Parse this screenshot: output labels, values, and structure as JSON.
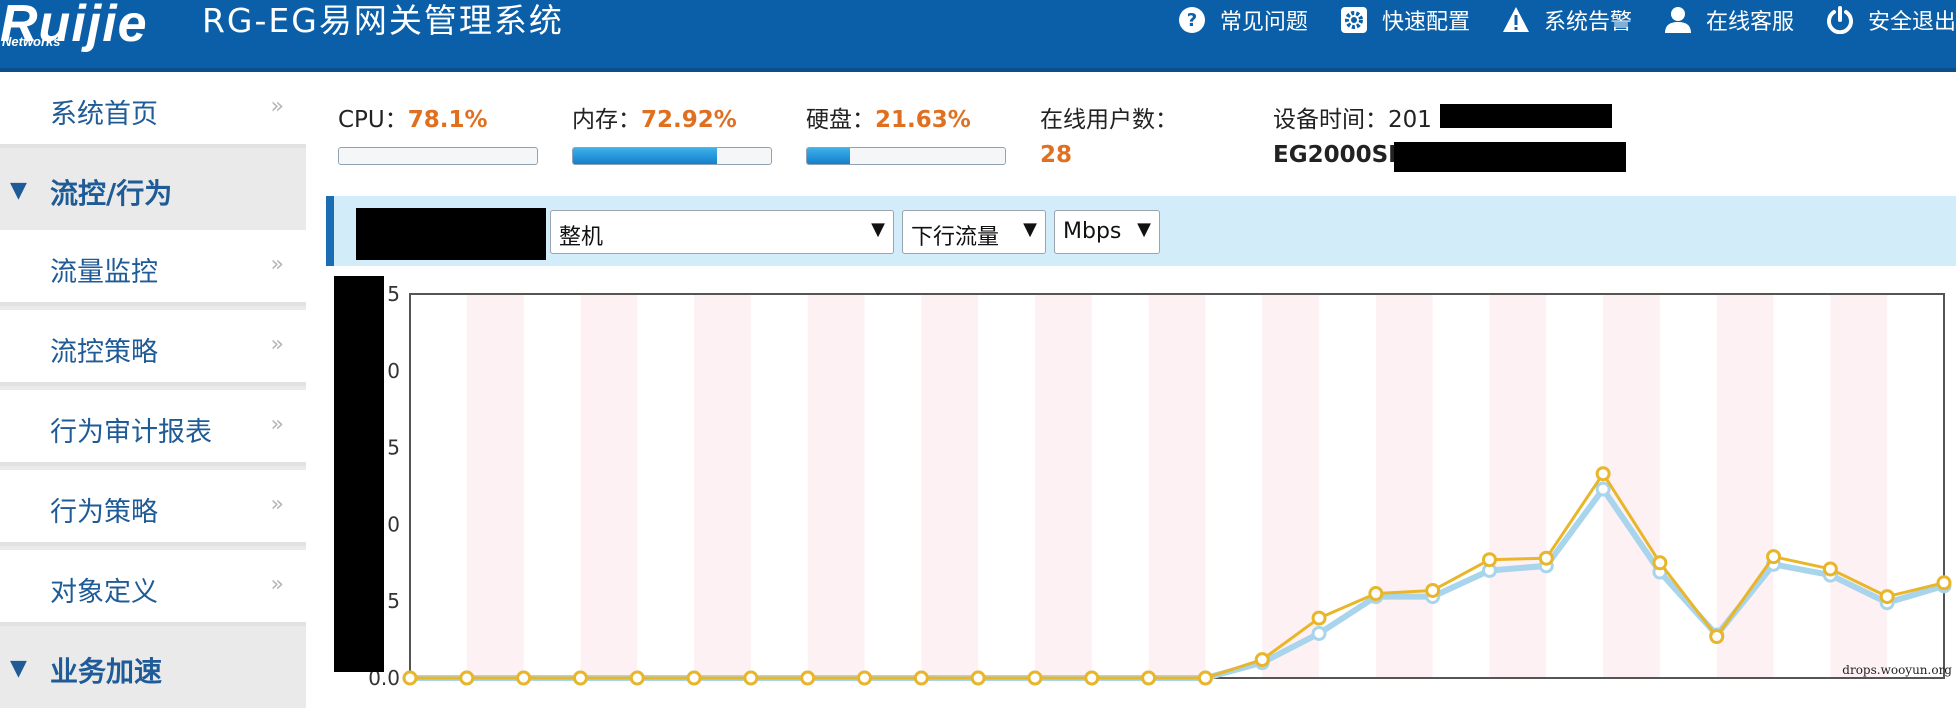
{
  "header": {
    "logo": "Ruijie",
    "logo_sub": "Networks",
    "title": "RG-EG易网关管理系统",
    "nav": [
      {
        "label": "常见问题",
        "icon": "help-icon"
      },
      {
        "label": "快速配置",
        "icon": "gear-icon"
      },
      {
        "label": "系统告警",
        "icon": "warning-icon"
      },
      {
        "label": "在线客服",
        "icon": "user-icon"
      },
      {
        "label": "安全退出",
        "icon": "power-icon"
      }
    ]
  },
  "sidebar": {
    "home": "系统首页",
    "group1": "流控/行为",
    "items": [
      "流量监控",
      "流控策略",
      "行为审计报表",
      "行为策略",
      "对象定义"
    ],
    "group2": "业务加速",
    "arrow": "»"
  },
  "stats": {
    "cpu_label": "CPU：",
    "cpu_value": "78.1%",
    "cpu_level": 0.0,
    "mem_label": "内存：",
    "mem_value": "72.92%",
    "mem_level": 0.7292,
    "disk_label": "硬盘：",
    "disk_value": "21.63%",
    "disk_level": 0.2163,
    "online_label": "在线用户数：",
    "online_value": "28",
    "time_label": "设备时间：",
    "time_value": "201",
    "model": "EG2000SE"
  },
  "toolbar": {
    "select1": "整机",
    "select2": "下行流量",
    "select3": "Mbps"
  },
  "watermark": "drops.wooyun.org",
  "chart_data": {
    "type": "line",
    "y_ticks": [
      "5",
      "0",
      "5",
      "0",
      "5",
      "0.0"
    ],
    "ylim": [
      0,
      25
    ],
    "x": [
      0,
      1,
      2,
      3,
      4,
      5,
      6,
      7,
      8,
      9,
      10,
      11,
      12,
      13,
      14,
      15,
      16,
      17,
      18,
      19,
      20,
      21,
      22,
      23,
      24,
      25,
      26,
      27
    ],
    "series": [
      {
        "color": "#e9b62a",
        "values": [
          0,
          0,
          0,
          0,
          0,
          0,
          0,
          0,
          0,
          0,
          0,
          0,
          0,
          0,
          0,
          1.2,
          3.9,
          5.5,
          5.7,
          7.7,
          7.8,
          13.3,
          7.5,
          2.7,
          7.9,
          7.1,
          5.3,
          6.2
        ]
      },
      {
        "color": "#a8d4ec",
        "values": [
          0,
          0,
          0,
          0,
          0,
          0,
          0,
          0,
          0,
          0,
          0,
          0,
          0,
          0,
          0,
          1.0,
          2.9,
          5.3,
          5.3,
          7.0,
          7.3,
          12.3,
          6.9,
          2.8,
          7.4,
          6.7,
          4.9,
          6.0
        ]
      }
    ],
    "grid": true
  }
}
